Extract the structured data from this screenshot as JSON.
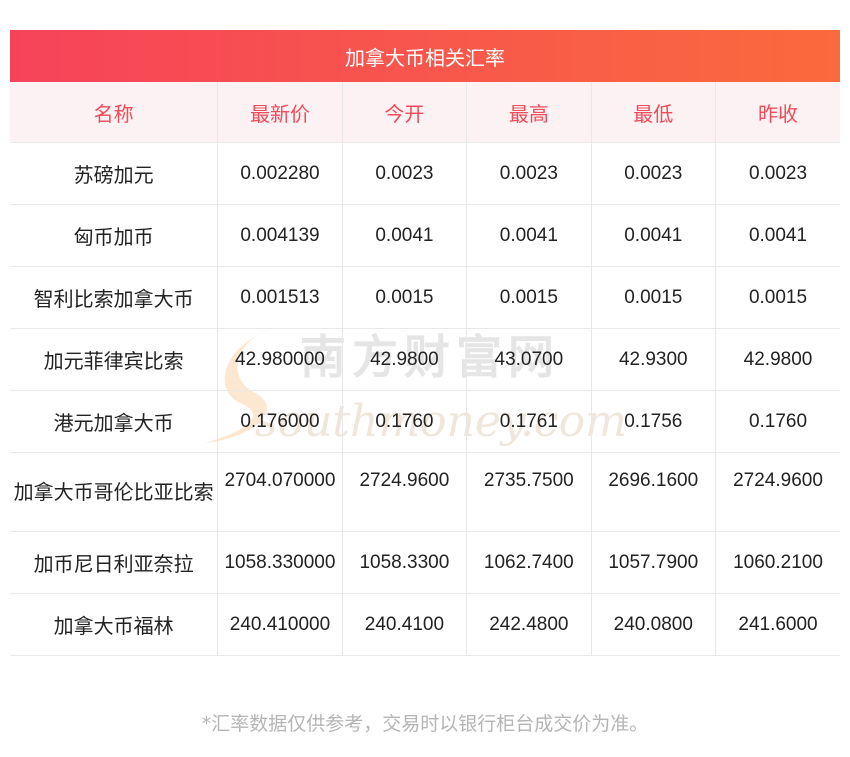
{
  "title": "加拿大币相关汇率",
  "headers": [
    "名称",
    "最新价",
    "今开",
    "最高",
    "最低",
    "昨收"
  ],
  "rows": [
    [
      "苏磅加元",
      "0.002280",
      "0.0023",
      "0.0023",
      "0.0023",
      "0.0023"
    ],
    [
      "匈币加币",
      "0.004139",
      "0.0041",
      "0.0041",
      "0.0041",
      "0.0041"
    ],
    [
      "智利比索加拿大币",
      "0.001513",
      "0.0015",
      "0.0015",
      "0.0015",
      "0.0015"
    ],
    [
      "加元菲律宾比索",
      "42.980000",
      "42.9800",
      "43.0700",
      "42.9300",
      "42.9800"
    ],
    [
      "港元加拿大币",
      "0.176000",
      "0.1760",
      "0.1761",
      "0.1756",
      "0.1760"
    ],
    [
      "加拿大币哥伦比亚比索",
      "2704.070000",
      "2724.9600",
      "2735.7500",
      "2696.1600",
      "2724.9600"
    ],
    [
      "加币尼日利亚奈拉",
      "1058.330000",
      "1058.3300",
      "1062.7400",
      "1057.7900",
      "1060.2100"
    ],
    [
      "加拿大币福林",
      "240.410000",
      "240.4100",
      "242.4800",
      "240.0800",
      "241.6000"
    ]
  ],
  "footnote": "*汇率数据仅供参考，交易时以银行柜台成交价为准。",
  "watermark": {
    "cn": "南方财富网",
    "en": "southmoney.com"
  },
  "colors": {
    "header_bar_start": "#f6435a",
    "header_bar_end": "#fa6a3d",
    "header_text": "#f14b5a",
    "footnote": "#b5b5b5"
  }
}
